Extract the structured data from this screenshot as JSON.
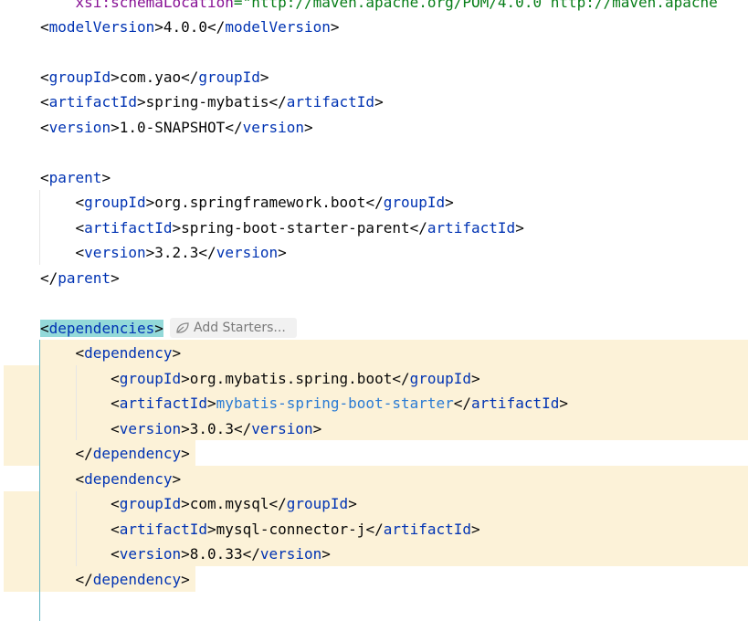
{
  "colors": {
    "tag": "#0033b3",
    "text": "#080808",
    "highlighted_value": "#2a7bd4",
    "attribute": "#871094",
    "string": "#067d17",
    "change_highlight": "#fcf2d8",
    "brace_match": "#93d9d9",
    "indent_guide": "#5fb4c2"
  },
  "editor": {
    "lines": [
      {
        "indent": "    ",
        "attr": "xsi:schemaLocation",
        "eq": "=",
        "value": "\"http://maven.apache.org/POM/4.0.0 http://maven.apache"
      },
      {
        "tag": "modelVersion",
        "value": "4.0.0"
      },
      {
        "tag": "groupId",
        "value": "com.yao"
      },
      {
        "tag": "artifactId",
        "value": "spring-mybatis"
      },
      {
        "tag": "version",
        "value": "1.0-SNAPSHOT"
      },
      {
        "open_tag": "parent"
      },
      {
        "indent": "    ",
        "tag": "groupId",
        "value": "org.springframework.boot"
      },
      {
        "indent": "    ",
        "tag": "artifactId",
        "value": "spring-boot-starter-parent"
      },
      {
        "indent": "    ",
        "tag": "version",
        "value": "3.2.3"
      },
      {
        "close_tag": "parent"
      },
      {
        "open_tag": "dependencies"
      },
      {
        "indent": "    ",
        "open_tag": "dependency"
      },
      {
        "indent": "        ",
        "tag": "groupId",
        "value": "org.mybatis.spring.boot"
      },
      {
        "indent": "        ",
        "tag": "artifactId",
        "value": "mybatis-spring-boot-starter"
      },
      {
        "indent": "        ",
        "tag": "version",
        "value": "3.0.3"
      },
      {
        "indent": "    ",
        "close_tag": "dependency"
      },
      {
        "indent": "    ",
        "open_tag": "dependency"
      },
      {
        "indent": "        ",
        "tag": "groupId",
        "value": "com.mysql"
      },
      {
        "indent": "        ",
        "tag": "artifactId",
        "value": "mysql-connector-j"
      },
      {
        "indent": "        ",
        "tag": "version",
        "value": "8.0.33"
      },
      {
        "indent": "    ",
        "close_tag": "dependency"
      }
    ],
    "add_starters_label": "Add Starters...",
    "add_starters_icon": "leaf-icon"
  }
}
